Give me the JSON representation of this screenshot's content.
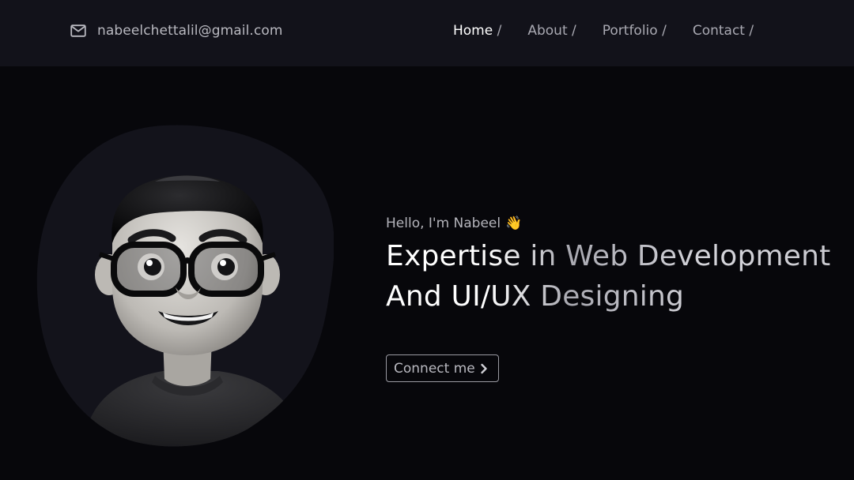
{
  "header": {
    "email": "nabeelchettalil@gmail.com",
    "email_icon": "mail-icon",
    "nav": [
      {
        "label": "Home",
        "separator": "/",
        "active": true
      },
      {
        "label": "About",
        "separator": "/",
        "active": false
      },
      {
        "label": "Portfolio",
        "separator": "/",
        "active": false
      },
      {
        "label": "Contact",
        "separator": "/",
        "active": false
      }
    ]
  },
  "hero": {
    "greeting": "Hello, I'm Nabeel",
    "greeting_emoji": "👋",
    "headline_line1": "Expertise in Web Development",
    "headline_line2": "And UI/UX Designing",
    "cta_label": "Connect me",
    "cta_icon": "chevron-right-icon",
    "avatar": "3d-avatar-with-glasses"
  },
  "colors": {
    "background": "#07070b",
    "header_background": "#12121a",
    "blob": "#13131b",
    "active_nav": "#ffffff",
    "muted_text": "#a9a9b2"
  }
}
